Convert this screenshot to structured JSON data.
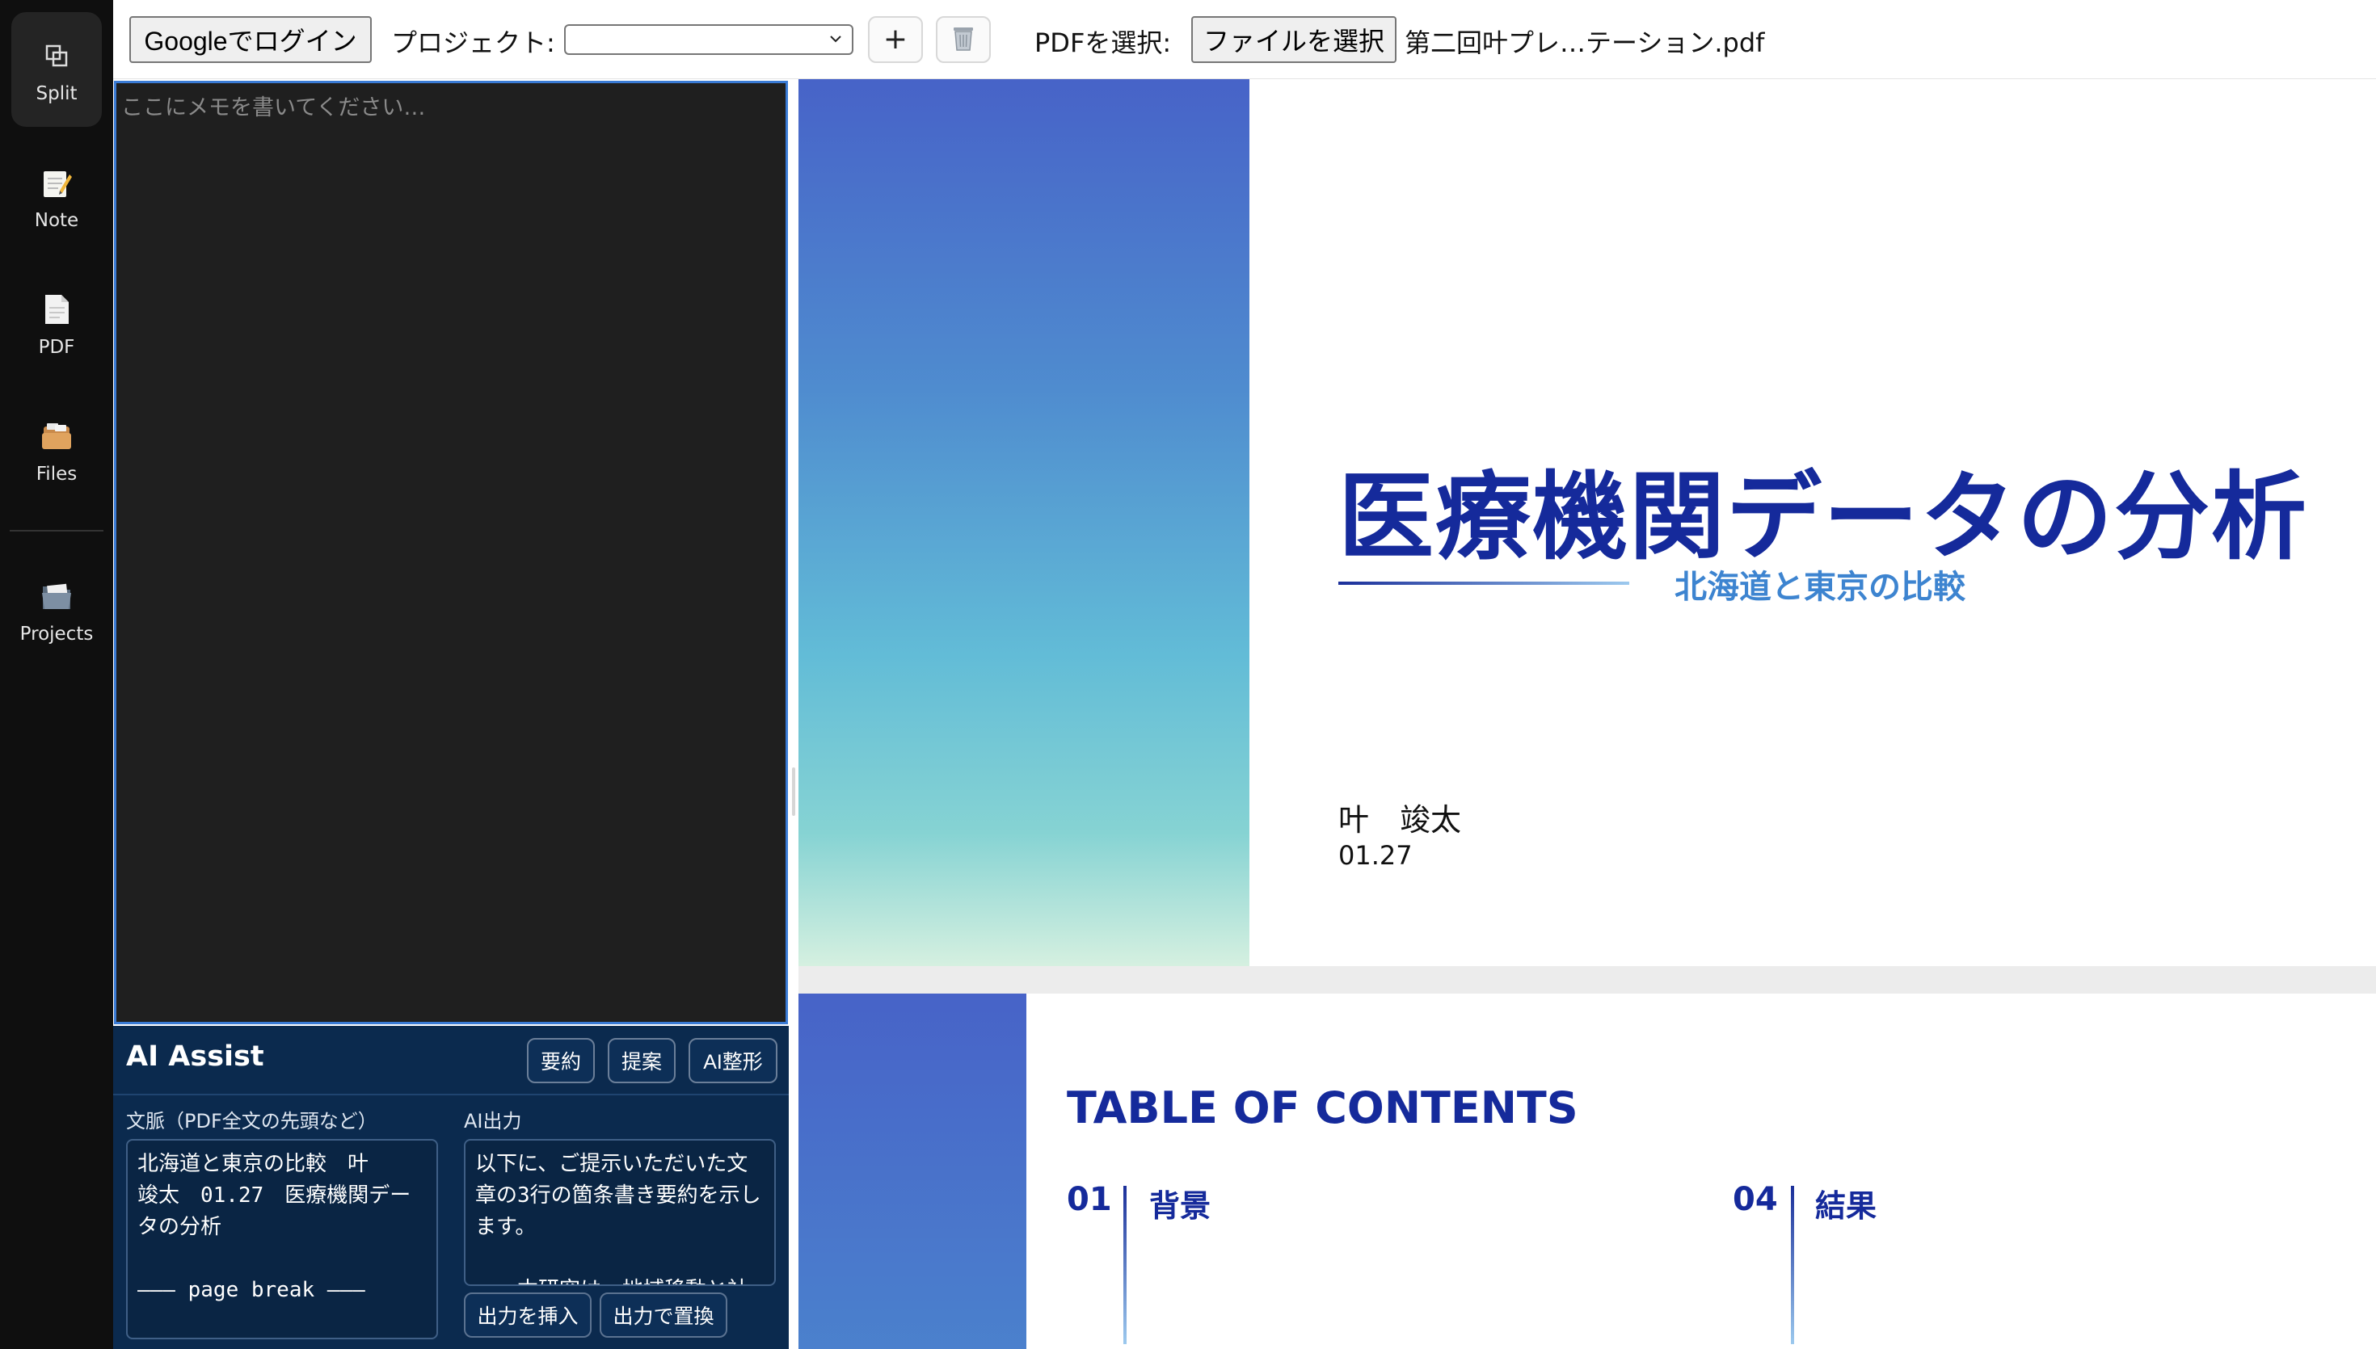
{
  "rail": {
    "items": [
      {
        "label": "Split",
        "icon": "split-icon"
      },
      {
        "label": "Note",
        "icon": "note-icon"
      },
      {
        "label": "PDF",
        "icon": "pdf-icon"
      },
      {
        "label": "Files",
        "icon": "files-icon"
      },
      {
        "label": "Projects",
        "icon": "projects-icon"
      }
    ]
  },
  "toolbar": {
    "login_label": "Googleでログイン",
    "project_label": "プロジェクト:",
    "project_value": "",
    "add_label": "+",
    "pdf_label": "PDFを選択:",
    "file_button_label": "ファイルを選択",
    "file_name": "第二回叶プレ…テーション.pdf"
  },
  "memo": {
    "placeholder": "ここにメモを書いてください…",
    "value": ""
  },
  "ai": {
    "title": "AI Assist",
    "buttons": [
      "要約",
      "提案",
      "AI整形"
    ],
    "context_label": "文脈（PDF全文の先頭など）",
    "context_text": "北海道と東京の比較　叶\n竣太　01.27　医療機関デー\nタの分析\n\n––– page break –––",
    "output_label": "AI出力",
    "output_text": "以下に、ご提示いただいた文\n章の3行の箇条書き要約を示し\nます。\n\n　　本研究は、地域移動と社",
    "insert_label": "出力を挿入",
    "replace_label": "出力で置換"
  },
  "pdf": {
    "slide1": {
      "title": "医療機関データの分析",
      "subtitle": "北海道と東京の比較",
      "author": "叶　竣太",
      "date": "01.27"
    },
    "slide2": {
      "title": "TABLE OF CONTENTS",
      "items": [
        {
          "num": "01",
          "label": "背景"
        },
        {
          "num": "04",
          "label": "結果"
        }
      ]
    }
  },
  "colors": {
    "accent": "#3a7bd5",
    "slide_navy": "#152a9b",
    "ai_panel": "#0b2a4e"
  }
}
